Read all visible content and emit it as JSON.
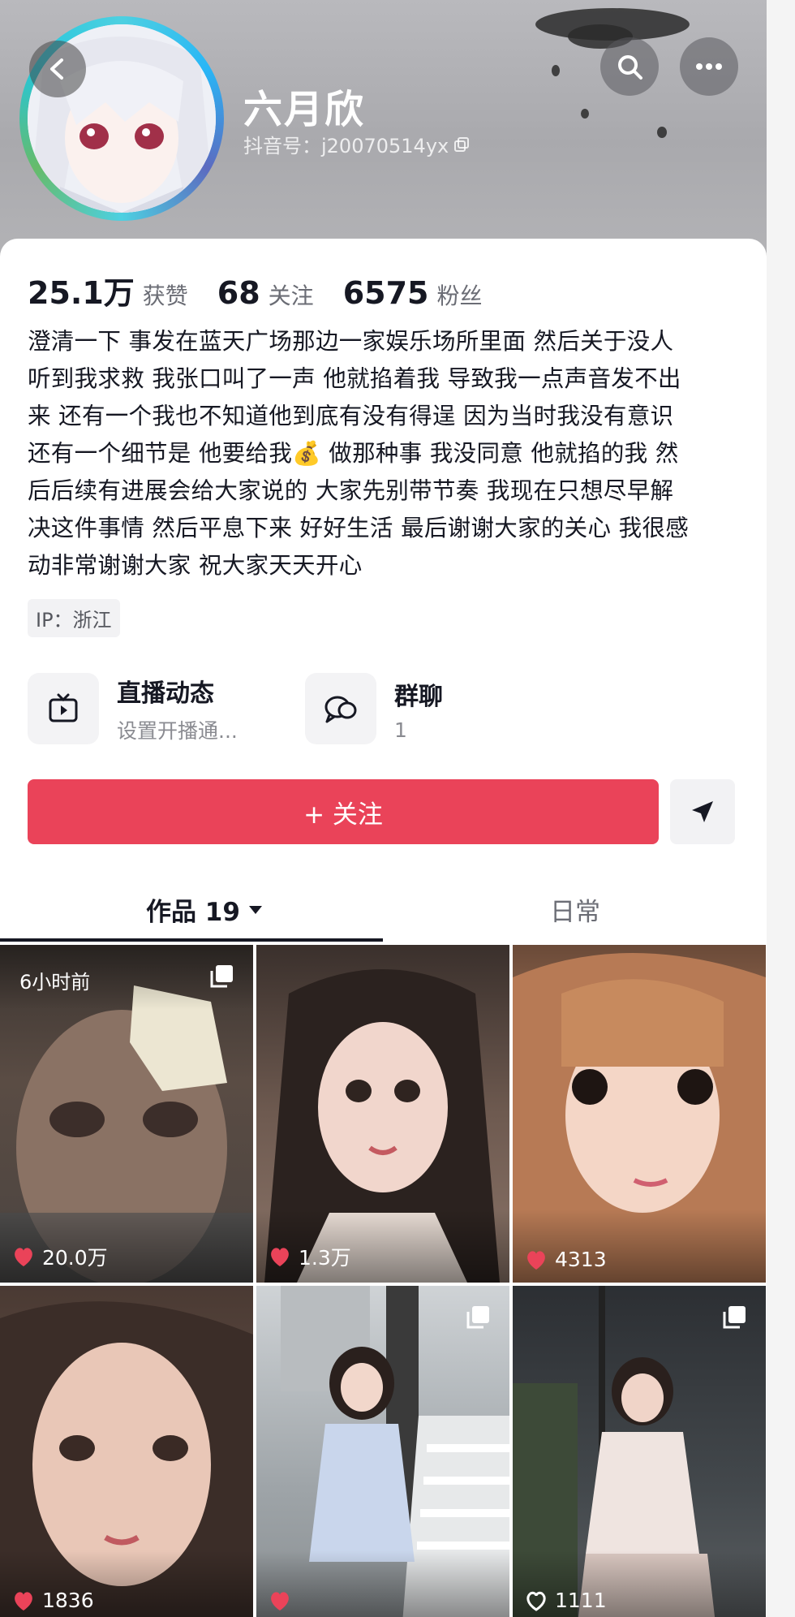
{
  "profile": {
    "name": "六月欣",
    "douyin_id": "抖音号：j20070514yx",
    "stats": [
      {
        "value": "25.1万",
        "label": "获赞"
      },
      {
        "value": "68",
        "label": "关注"
      },
      {
        "value": "6575",
        "label": "粉丝"
      }
    ],
    "bio_lines": [
      "澄清一下 事发在蓝天广场那边一家娱乐场所里面 然后关于没人",
      "听到我求救 我张口叫了一声 他就掐着我 导致我一点声音发不出",
      "来 还有一个我也不知道他到底有没有得逞 因为当时我没有意识",
      "还有一个细节是 他要给我💰 做那种事 我没同意 他就掐的我 然",
      "后后续有进展会给大家说的 大家先别带节奏 我现在只想尽早解",
      "决这件事情 然后平息下来 好好生活 最后谢谢大家的关心 我很感",
      "动非常谢谢大家 祝大家天天开心"
    ],
    "ip": "IP：浙江"
  },
  "features": [
    {
      "title": "直播动态",
      "subtitle": "设置开播通...",
      "icon": "live-tv-icon"
    },
    {
      "title": "群聊",
      "subtitle": "1",
      "icon": "group-chat-icon"
    }
  ],
  "actions": {
    "follow_label": "+ 关注",
    "share_icon": "send-icon"
  },
  "tabs": [
    {
      "label": "作品 19",
      "active": true
    },
    {
      "label": "日常",
      "active": false
    }
  ],
  "videos": [
    {
      "likes": "20.0万",
      "badge": "6小时前",
      "multi": true,
      "liked": true
    },
    {
      "likes": "1.3万",
      "badge": "",
      "multi": false,
      "liked": true
    },
    {
      "likes": "4313",
      "badge": "",
      "multi": false,
      "liked": true
    },
    {
      "likes": "1836",
      "badge": "",
      "multi": false,
      "liked": true
    },
    {
      "likes": "",
      "badge": "",
      "multi": true,
      "liked": true
    },
    {
      "likes": "1111",
      "badge": "",
      "multi": true,
      "liked": false
    }
  ],
  "colors": {
    "accent": "#ea4359",
    "text": "#161823",
    "muted": "#8a8b91"
  }
}
